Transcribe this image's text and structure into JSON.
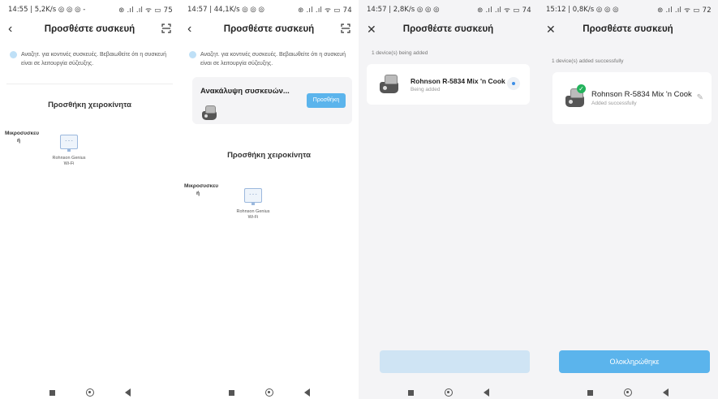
{
  "colors": {
    "accent": "#5bb4ec",
    "success": "#23b35c",
    "disabled": "#cfe4f4"
  },
  "icons": {
    "back": "chevron-left-icon",
    "close": "close-icon",
    "scan": "scan-icon",
    "edit": "pencil-icon",
    "tip": "lightbulb-icon"
  },
  "screen1": {
    "status_left": "14:55 | 5,2K/s ◎ ◎ ◎ -",
    "status_right": "⊛ .ıl .ıl ᯤ ▭ 75",
    "title": "Προσθέστε συσκευή",
    "tip": "Αναζητ. για κοντινές συσκευές. Βεβαιωθείτε ότι η συσκευή είναι σε λειτουργία σύζευξης.",
    "manual_title": "Προσθήκη χειροκίνητα",
    "category": "Μικροσυσκευ ή",
    "device_label": "Rohnson Genius Wi-Fi"
  },
  "screen2": {
    "status_left": "14:57 | 44,1K/s ◎ ◎ ◎",
    "status_right": "⊛ .ıl .ıl ᯤ ▭ 74",
    "title": "Προσθέστε συσκευή",
    "tip": "Αναζητ. για κοντινές συσκευές. Βεβαιωθείτε ότι η συσκευή είναι σε λειτουργία σύζευξης.",
    "discovery_title": "Ανακάλυψη συσκευών...",
    "add_button": "Προσθήκη",
    "manual_title": "Προσθήκη χειροκίνητα",
    "category": "Μικροσυσκευ ή",
    "device_label": "Rohnson Genius Wi-Fi"
  },
  "screen3": {
    "status_left": "14:57 | 2,8K/s ◎ ◎ ◎",
    "status_right": "⊛ .ıl .ıl ᯤ ▭ 74",
    "title": "Προσθέστε συσκευή",
    "count_label": "1 device(s) being added",
    "device_name": "Rohnson R-5834 Mix 'n Cook",
    "device_status": "Being added"
  },
  "screen4": {
    "status_left": "15:12 | 0,8K/s ◎ ◎ ◎",
    "status_right": "⊛ .ıl .ıl ᯤ ▭ 72",
    "title": "Προσθέστε συσκευή",
    "count_label": "1 device(s) added successfully",
    "device_name": "Rohnson R-5834 Mix 'n Cook",
    "device_status": "Added successfully",
    "done_button": "Ολοκληρώθηκε"
  }
}
